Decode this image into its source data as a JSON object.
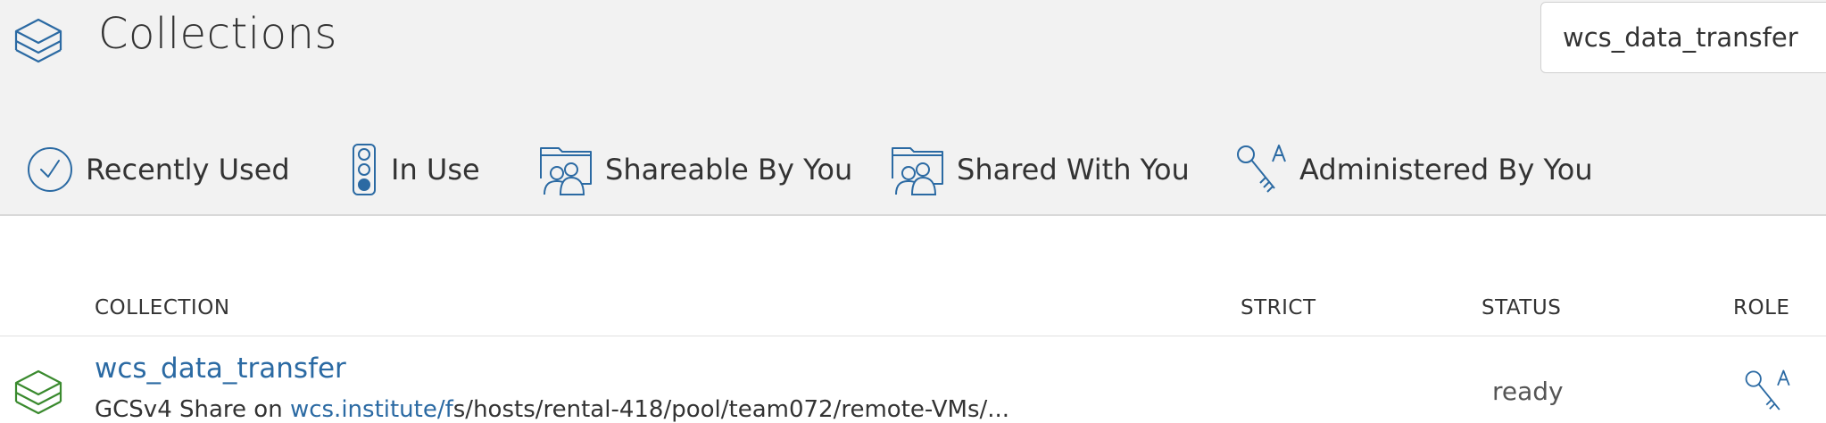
{
  "header": {
    "title": "Collections",
    "search_value": "wcs_data_transfer",
    "app_icon": "layers-icon"
  },
  "tabs": [
    {
      "label": "Recently Used",
      "icon": "clock-icon"
    },
    {
      "label": "In Use",
      "icon": "traffic-light-icon"
    },
    {
      "label": "Shareable By You",
      "icon": "shared-folder-icon"
    },
    {
      "label": "Shared With You",
      "icon": "shared-folder-icon"
    },
    {
      "label": "Administered By You",
      "icon": "admin-key-icon"
    }
  ],
  "table": {
    "columns": {
      "collection": "COLLECTION",
      "strict": "STRICT",
      "status": "STATUS",
      "role": "ROLE"
    },
    "rows": [
      {
        "name": "wcs_data_transfer",
        "subtitle_prefix": "GCSv4 Share on ",
        "subtitle_link": "wcs.institute/f",
        "subtitle_rest": "s/hosts/rental-418/pool/team072/remote-VMs/...",
        "status": "ready",
        "role_icon": "admin-key-icon",
        "collection_icon": "layers-icon"
      }
    ]
  },
  "colors": {
    "accent": "#2b6aa3",
    "header_bg": "#f2f2f2",
    "row_icon": "#3a8a2e"
  }
}
